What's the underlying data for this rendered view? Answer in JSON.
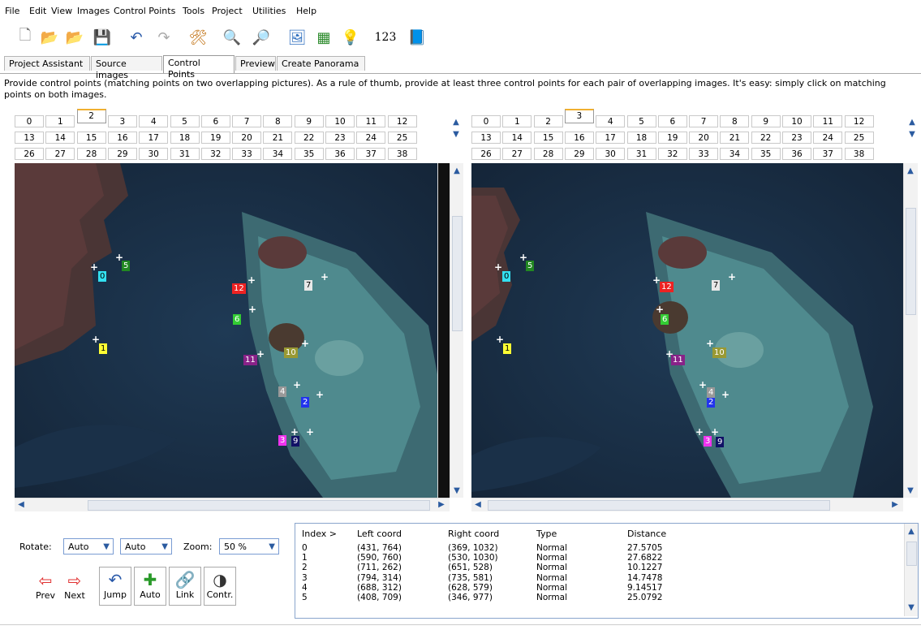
{
  "menu": [
    "File",
    "Edit",
    "View",
    "Images",
    "Control Points",
    "Tools",
    "Project",
    "Utilities",
    "Help"
  ],
  "toolbar": {
    "icons": [
      "new-document-icon",
      "open-folder-icon",
      "open-template-icon",
      "save-icon",
      "undo-icon",
      "redo-icon",
      "preferences-icon",
      "zoom-in-icon",
      "zoom-out-icon",
      "preview-icon",
      "table-icon",
      "tip-icon",
      "numbers-icon",
      "help-book-icon"
    ],
    "numbers_label": "123"
  },
  "tabs": [
    "Project Assistant",
    "Source images",
    "Control Points",
    "Preview",
    "Create Panorama"
  ],
  "instructions": "Provide control points (matching points on two overlapping pictures). As a rule of thumb, provide at least three control points for each pair of overlapping images. It's easy: simply click on matching points on both images.",
  "left_image": {
    "selected": "2",
    "numbers": [
      "0",
      "1",
      "2",
      "3",
      "4",
      "5",
      "6",
      "7",
      "8",
      "9",
      "10",
      "11",
      "12",
      "13",
      "14",
      "15",
      "16",
      "17",
      "18",
      "19",
      "20",
      "21",
      "22",
      "23",
      "24",
      "25",
      "26",
      "27",
      "28",
      "29",
      "30",
      "31",
      "32",
      "33",
      "34",
      "35",
      "36",
      "37",
      "38"
    ]
  },
  "right_image": {
    "selected": "3",
    "numbers": [
      "0",
      "1",
      "2",
      "3",
      "4",
      "5",
      "6",
      "7",
      "8",
      "9",
      "10",
      "11",
      "12",
      "13",
      "14",
      "15",
      "16",
      "17",
      "18",
      "19",
      "20",
      "21",
      "22",
      "23",
      "24",
      "25",
      "26",
      "27",
      "28",
      "29",
      "30",
      "31",
      "32",
      "33",
      "34",
      "35",
      "36",
      "37",
      "38"
    ]
  },
  "control_point_labels": [
    "0",
    "1",
    "2",
    "3",
    "4",
    "5",
    "6",
    "7",
    "9",
    "10",
    "11",
    "12"
  ],
  "control_point_colors": {
    "0": "#33e0f0",
    "1": "#ffff33",
    "2": "#2233ee",
    "3": "#ee33ee",
    "4": "#999999",
    "5": "#228822",
    "6": "#33cc33",
    "7": "#e8e8e8",
    "9": "#111166",
    "10": "#999933",
    "11": "#882288",
    "12": "#ee2222"
  },
  "controls": {
    "rotate_label": "Rotate:",
    "rotate_left": "Auto",
    "rotate_right": "Auto",
    "zoom_label": "Zoom:",
    "zoom_value": "50 %",
    "buttons": [
      "Prev",
      "Next",
      "Jump",
      "Auto",
      "Link",
      "Contr."
    ]
  },
  "cp_table": {
    "headers": [
      "Index >",
      "Left coord",
      "Right coord",
      "Type",
      "Distance"
    ],
    "rows": [
      [
        "0",
        "(431, 764)",
        "(369, 1032)",
        "Normal",
        "27.5705"
      ],
      [
        "1",
        "(590, 760)",
        "(530, 1030)",
        "Normal",
        "27.6822"
      ],
      [
        "2",
        "(711, 262)",
        "(651, 528)",
        "Normal",
        "10.1227"
      ],
      [
        "3",
        "(794, 314)",
        "(735, 581)",
        "Normal",
        "14.7478"
      ],
      [
        "4",
        "(688, 312)",
        "(628, 579)",
        "Normal",
        "9.14517"
      ],
      [
        "5",
        "(408, 709)",
        "(346, 977)",
        "Normal",
        "25.0792"
      ]
    ]
  }
}
